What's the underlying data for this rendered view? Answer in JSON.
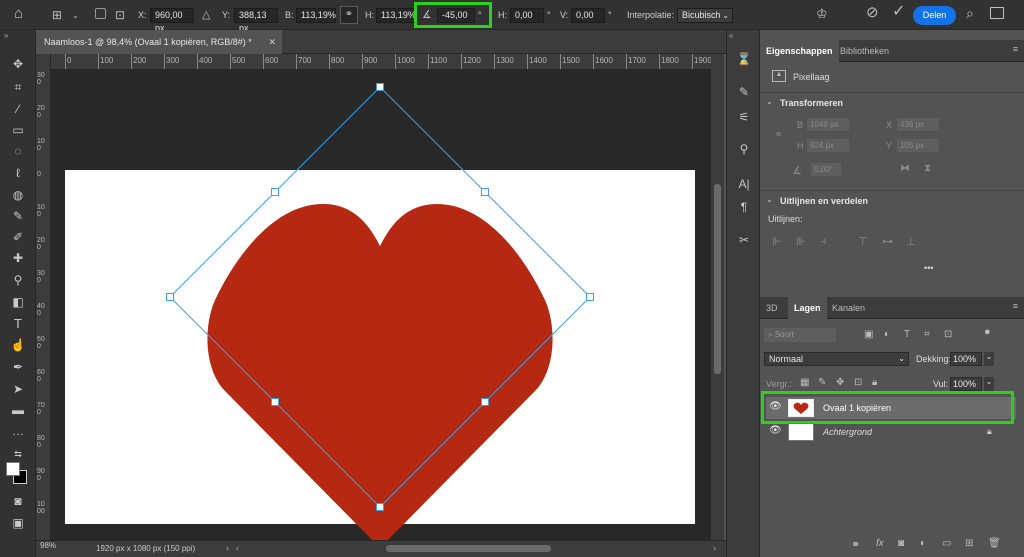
{
  "options_bar": {
    "x_label": "X:",
    "x_value": "960,00 px",
    "y_label": "Y:",
    "y_value": "388,13 px",
    "w_label": "B:",
    "w_value": "113,19%",
    "h_label": "H:",
    "h_value": "113,19%",
    "angle_value": "-45,00",
    "angle_unit": "°",
    "skew_h_label": "H:",
    "skew_h_value": "0,00",
    "skew_h_unit": "°",
    "skew_v_label": "V:",
    "skew_v_value": "0,00",
    "skew_v_unit": "°",
    "interpolation_label": "Interpolatie:",
    "interpolation_value": "Bicubisch",
    "share_label": "Delen"
  },
  "document": {
    "tab_title": "Naamloos-1 @ 98,4% (Ovaal 1 kopiëren, RGB/8#) *",
    "status_zoom": "98%",
    "status_info": "1920 px x 1080 px (150 ppi)"
  },
  "rulers": {
    "h_ticks": [
      "0",
      "100",
      "200",
      "300",
      "400",
      "500",
      "600",
      "700",
      "800",
      "900",
      "1000",
      "1100",
      "1200",
      "1300",
      "1400",
      "1500",
      "1600",
      "1700",
      "1800",
      "1900"
    ],
    "v_ticks": [
      "300",
      "200",
      "100",
      "0",
      "100",
      "200",
      "300",
      "400",
      "500",
      "600",
      "700",
      "800",
      "900",
      "1000"
    ]
  },
  "properties_panel": {
    "tabs": [
      "Eigenschappen",
      "Bibliotheken"
    ],
    "layer_kind": "Pixellaag",
    "transform_title": "Transformeren",
    "w_label": "B",
    "w_value": "1049 px",
    "x_label": "X",
    "x_value": "436 px",
    "h_label": "H",
    "h_value": "924 px",
    "y_label": "Y",
    "y_value": "105 px",
    "angle_value": "0,00°",
    "align_title": "Uitlijnen en verdelen",
    "align_label": "Uitlijnen:",
    "more": "•••"
  },
  "layers_panel": {
    "tabs": [
      "3D",
      "Lagen",
      "Kanalen"
    ],
    "filter_placeholder": "Soort",
    "blend_mode": "Normaal",
    "opacity_label": "Dekking:",
    "opacity_value": "100%",
    "lock_label": "Vergr.:",
    "fill_label": "Vul:",
    "fill_value": "100%",
    "layers": [
      {
        "name": "Ovaal 1 kopiëren",
        "selected": true
      },
      {
        "name": "Achtergrond",
        "selected": false
      }
    ]
  },
  "colors": {
    "highlight": "#2bd11b",
    "heart": "#b52812",
    "accent": "#1473e6",
    "bbox": "#3d9ee8"
  }
}
